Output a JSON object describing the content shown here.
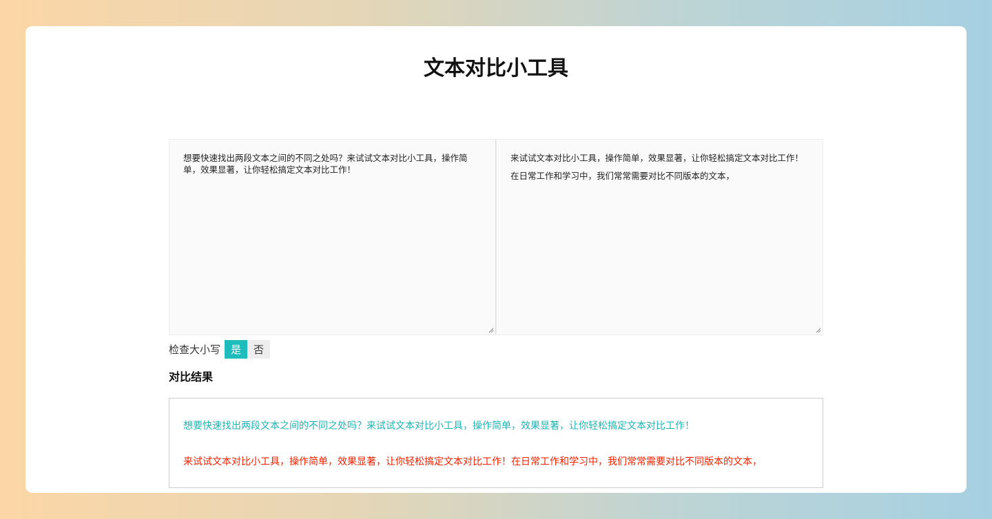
{
  "page": {
    "title": "文本对比小工具"
  },
  "editors": {
    "left": {
      "paragraphs": [
        "想要快速找出两段文本之间的不同之处吗？来试试文本对比小工具，操作简单，效果显著，让你轻松搞定文本对比工作！"
      ]
    },
    "right": {
      "paragraphs": [
        "来试试文本对比小工具，操作简单，效果显著，让你轻松搞定文本对比工作！",
        "在日常工作和学习中，我们常常需要对比不同版本的文本，"
      ]
    }
  },
  "case_check": {
    "label": "检查大小写",
    "yes_label": "是",
    "no_label": "否",
    "selected": "是"
  },
  "result": {
    "heading": "对比结果",
    "lines": [
      {
        "type": "added",
        "text": "想要快速找出两段文本之间的不同之处吗？来试试文本对比小工具，操作简单，效果显著，让你轻松搞定文本对比工作！"
      },
      {
        "type": "removed",
        "text": "来试试文本对比小工具，操作简单，效果显著，让你轻松搞定文本对比工作！在日常工作和学习中，我们常常需要对比不同版本的文本，"
      }
    ]
  },
  "colors": {
    "accent": "#1fbcbc",
    "added_text": "#1fb3b3",
    "removed_text": "#ee2200"
  },
  "icons": {
    "resize_handle": "resize-grip-icon"
  }
}
